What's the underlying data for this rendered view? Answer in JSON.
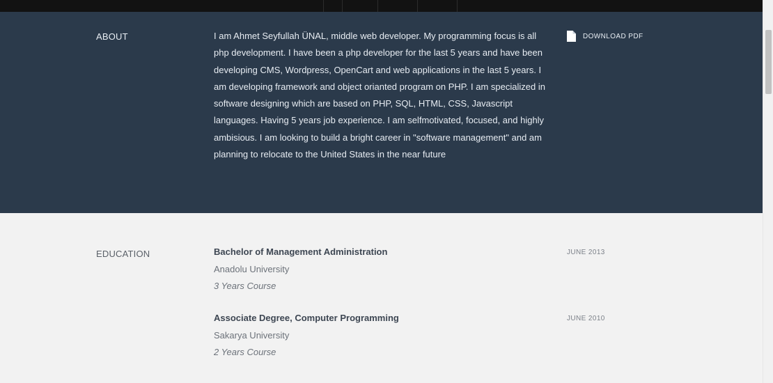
{
  "about": {
    "label": "ABOUT",
    "text": "I am Ahmet Seyfullah ÜNAL, middle web developer. My programming focus is all php development. I have been a php developer for the last 5 years and have been developing CMS, Wordpress, OpenCart and web applications in the last 5 years. I am developing framework and object orianted program on PHP. I am specialized in software designing which are based on PHP, SQL, HTML, CSS, Javascript languages. Having 5 years job experience. I am selfmotivated, focused, and highly ambisious. I am looking to build a bright career in \"software management\" and am planning to relocate to the United States in the near future",
    "download_label": "DOWNLOAD PDF",
    "download_icon": "file-icon"
  },
  "education": {
    "label": "EDUCATION",
    "items": [
      {
        "degree": "Bachelor of Management Administration",
        "school": "Anadolu University",
        "duration": "3 Years Course",
        "date": "JUNE 2013"
      },
      {
        "degree": "Associate Degree, Computer Programming",
        "school": "Sakarya University",
        "duration": "2 Years Course",
        "date": "JUNE 2010"
      }
    ]
  },
  "colors": {
    "topbar": "#121212",
    "about_bg": "#2b3a4b",
    "page_bg": "#f2f2f2",
    "heading_text": "#3d4652"
  }
}
